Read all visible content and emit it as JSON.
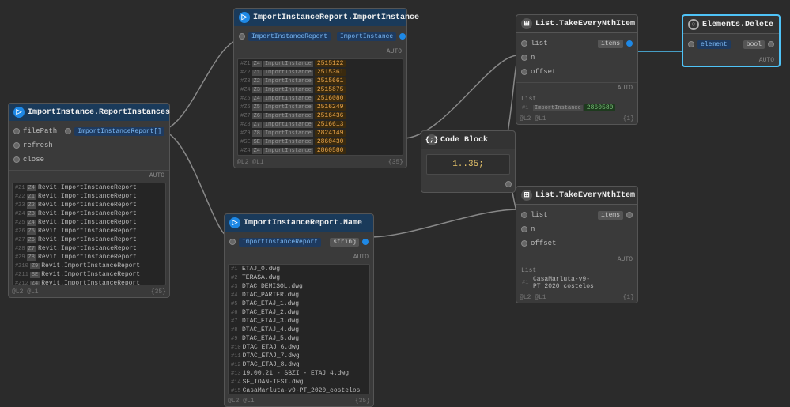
{
  "nodes": {
    "importInstanceReport": {
      "title": "ImportInstance.ReportInstances",
      "ports_in": [
        "filePath",
        "refresh",
        "close"
      ],
      "port_out": "ImportInstanceReport[]",
      "footer": "AUTO",
      "list_items": [
        "Revit.ImportInstanceReport",
        "Revit.ImportInstanceReport",
        "Revit.ImportInstanceReport",
        "Revit.ImportInstanceReport",
        "Revit.ImportInstanceReport",
        "Revit.ImportInstanceReport",
        "Revit.ImportInstanceReport",
        "Revit.ImportInstanceReport",
        "Revit.ImportInstanceReport",
        "Revit.ImportInstanceReport",
        "Revit.ImportInstanceReport",
        "Revit.ImportInstanceReport",
        "Revit.ImportInstanceReport",
        "Revit.ImportInstanceReport",
        "Revit.ImportInstanceReport"
      ],
      "count": "{35}"
    },
    "importInstanceMain": {
      "title": "ImportInstanceReport.ImportInstance",
      "port_in": "ImportInstanceReport",
      "port_out": "ImportInstance",
      "footer": "AUTO",
      "list_items": [
        {
          "idx": "#Z1",
          "type": "ImportInstance",
          "val": "2515122"
        },
        {
          "idx": "#Z2",
          "type": "ImportInstance",
          "val": "2515361"
        },
        {
          "idx": "#Z3",
          "type": "ImportInstance",
          "val": "2515661"
        },
        {
          "idx": "#Z4",
          "type": "ImportInstance",
          "val": "2515875"
        },
        {
          "idx": "#Z5",
          "type": "ImportInstance",
          "val": "2516080"
        },
        {
          "idx": "#Z6",
          "type": "ImportInstance",
          "val": "2516249"
        },
        {
          "idx": "#Z7",
          "type": "ImportInstance",
          "val": "2516436"
        },
        {
          "idx": "#Z8",
          "type": "ImportInstance",
          "val": "2516613"
        },
        {
          "idx": "#Z9",
          "type": "ImportInstance",
          "val": "2824149"
        },
        {
          "idx": "#SE",
          "type": "ImportInstance",
          "val": "2860430"
        },
        {
          "idx": "#Z4",
          "type": "ImportInstance",
          "val": "2860580"
        }
      ],
      "count": "{35}"
    },
    "listTakeNth1": {
      "title": "List.TakeEveryNthItem",
      "ports": [
        "list",
        "n",
        "offset"
      ],
      "port_out": "items",
      "footer": "AUTO",
      "list_items": [
        {
          "idx": "#1",
          "type": "ImportInstance",
          "val": "2860580"
        }
      ],
      "count": "{1}"
    },
    "elementsDelete": {
      "title": "Elements.Delete",
      "port_in": "element",
      "port_out": "bool",
      "footer": "AUTO"
    },
    "codeBlock": {
      "title": "Code Block",
      "value": "1..35;"
    },
    "importInstanceName": {
      "title": "ImportInstanceReport.Name",
      "port_in": "ImportInstanceReport",
      "port_out": "string",
      "footer": "AUTO",
      "list_items": [
        "ETAJ_0.dwg",
        "TERASA.dwg",
        "DTAC_DEMISOL.dwg",
        "DTAC_PARTER.dwg",
        "DTAC_ETAJ_1.dwg",
        "DTAC_ETAJ_2.dwg",
        "DTAC_ETAJ_3.dwg",
        "DTAC_ETAJ_4.dwg",
        "DTAC_ETAJ_5.dwg",
        "DTAC_ETAJ_6.dwg",
        "DTAC_ETAJ_7.dwg",
        "DTAC_ETAJ_8.dwg",
        "19.00.21 - SBZI - ETAJ 4.dwg",
        "SF_IOAN-TEST.dwg",
        "CasaMarluta-v9-PT_2020_costelos"
      ],
      "count": "{35}"
    },
    "listTakeNth2": {
      "title": "List.TakeEveryNthItem",
      "ports": [
        "list",
        "n",
        "offset"
      ],
      "port_out": "items",
      "footer": "AUTO",
      "list_items": [
        {
          "idx": "#1",
          "type": "",
          "val": "CasaMarluta-v9-PT_2020_costelos"
        }
      ],
      "count": "{1}"
    }
  },
  "colors": {
    "accent": "#1e88e5",
    "node_bg": "#3a3a3a",
    "canvas_bg": "#2b2b2b",
    "orange_val": "#e8a44a",
    "green_val": "#7abf7a"
  }
}
